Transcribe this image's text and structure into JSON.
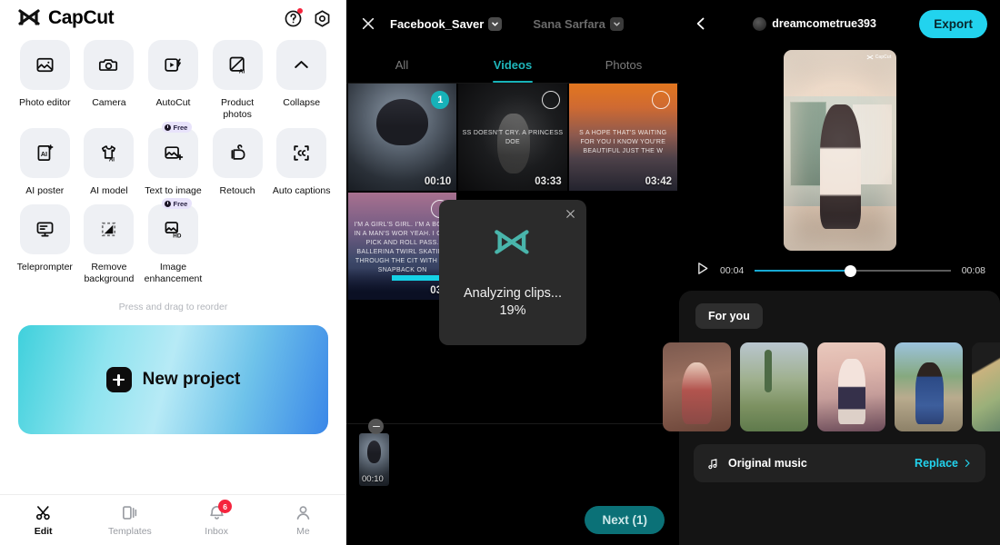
{
  "left": {
    "brand": "CapCut",
    "header_icons": [
      {
        "name": "help-icon",
        "has_badge": true
      },
      {
        "name": "settings-icon",
        "has_badge": false
      }
    ],
    "tools": [
      {
        "label": "Photo editor",
        "icon": "photo-editor-icon",
        "free": false
      },
      {
        "label": "Camera",
        "icon": "camera-icon",
        "free": false
      },
      {
        "label": "AutoCut",
        "icon": "autocut-icon",
        "free": false
      },
      {
        "label": "Product photos",
        "icon": "product-photos-icon",
        "free": false
      },
      {
        "label": "Collapse",
        "icon": "chevron-up-icon",
        "free": false
      },
      {
        "label": "AI poster",
        "icon": "ai-poster-icon",
        "free": false
      },
      {
        "label": "AI model",
        "icon": "ai-model-icon",
        "free": false
      },
      {
        "label": "Text to image",
        "icon": "text-to-image-icon",
        "free": true
      },
      {
        "label": "Retouch",
        "icon": "retouch-icon",
        "free": false
      },
      {
        "label": "Auto captions",
        "icon": "auto-captions-icon",
        "free": false
      },
      {
        "label": "Teleprompter",
        "icon": "teleprompter-icon",
        "free": false
      },
      {
        "label": "Remove background",
        "icon": "remove-background-icon",
        "free": false
      },
      {
        "label": "Image enhancement",
        "icon": "image-enhancement-icon",
        "free": true
      }
    ],
    "free_badge_label": "Free",
    "reorder_hint": "Press and drag to reorder",
    "new_project_label": "New project",
    "bottom_nav": [
      {
        "label": "Edit",
        "icon": "scissors-icon",
        "active": true,
        "badge": ""
      },
      {
        "label": "Templates",
        "icon": "templates-icon",
        "active": false,
        "badge": ""
      },
      {
        "label": "Inbox",
        "icon": "bell-icon",
        "active": false,
        "badge": "6"
      },
      {
        "label": "Me",
        "icon": "person-icon",
        "active": false,
        "badge": ""
      }
    ]
  },
  "middle": {
    "close_icon": "close-icon",
    "album_title": "Facebook_Saver",
    "account_title": "Sana Sarfara",
    "tabs": [
      {
        "label": "All",
        "active": false
      },
      {
        "label": "Videos",
        "active": true
      },
      {
        "label": "Photos",
        "active": false
      }
    ],
    "media": [
      {
        "duration": "00:10",
        "selected": true,
        "order": "1",
        "caption": "",
        "art": "art1"
      },
      {
        "duration": "03:33",
        "selected": false,
        "order": "",
        "caption": "SS DOESN'T CRY. A PRINCESS DOE",
        "art": "art2"
      },
      {
        "duration": "03:42",
        "selected": false,
        "order": "",
        "caption": "S A HOPE THAT'S WAITING FOR YOU I KNOW YOU'RE BEAUTIFUL JUST THE W",
        "art": "art3"
      },
      {
        "duration": "03:2",
        "selected": false,
        "order": "",
        "caption": "I'M A GIRL'S GIRL. I'M A BOSS IN A MAN'S WOR YEAH. I CAN PICK AND ROLL PASS. BALLERINA TWIRL SKATING THROUGH THE CIT WITH MY SNAPBACK ON",
        "art": "art4"
      }
    ],
    "modal": {
      "logo": "capcut-logo-icon",
      "title": "Analyzing clips...",
      "percent": "19%",
      "close_icon": "close-icon"
    },
    "selected_clip": {
      "duration": "00:10",
      "remove_icon": "minus-icon"
    },
    "next_label": "Next (1)"
  },
  "right": {
    "back_icon": "chevron-left-icon",
    "username": "dreamcometrue393",
    "export_label": "Export",
    "watermark": "CapCut",
    "player": {
      "play_icon": "play-icon",
      "current_time": "00:04",
      "total_time": "00:08",
      "progress_percent": 49
    },
    "foryou_label": "For you",
    "templates": [
      {
        "id": "template-1",
        "art": "t1"
      },
      {
        "id": "template-2",
        "art": "t2"
      },
      {
        "id": "template-3",
        "art": "t3"
      },
      {
        "id": "template-4",
        "art": "t4"
      },
      {
        "id": "template-5",
        "art": "t5"
      }
    ],
    "music": {
      "icon": "music-note-icon",
      "label": "Original music",
      "replace_label": "Replace"
    }
  },
  "colors": {
    "accent_teal": "#17b2b8",
    "accent_cyan": "#22d3ee",
    "badge_red": "#f5243d",
    "next_btn": "#0b7177"
  }
}
